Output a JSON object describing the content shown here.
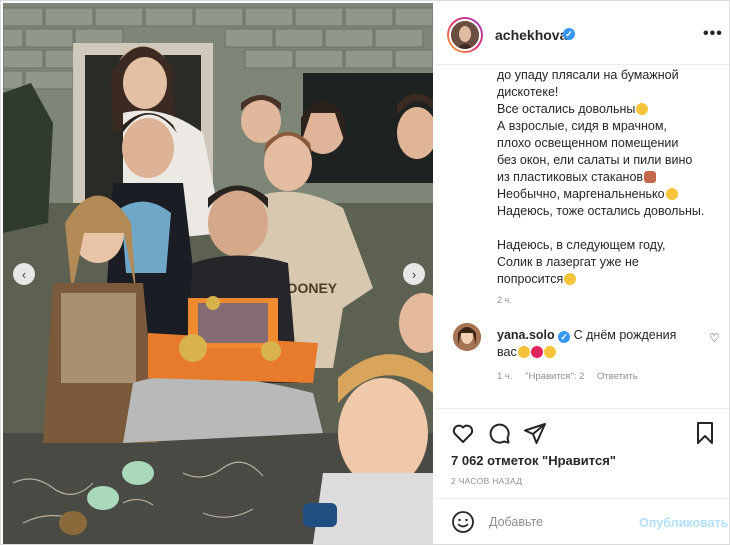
{
  "post": {
    "username": "achekhova",
    "verified": true,
    "more_label": "•••"
  },
  "caption": {
    "para1": "до упаду плясали на бумажной\nдискотеке!\nВсе остались довольны",
    "para1b": "А взрослые, сидя в мрачном,\nплохо освещенном помещении\nбез окон, ели салаты и пили вино\nиз пластиковых стаканов",
    "para1c": "Необычно, маргенальненько",
    "para1d": "Надеюсь, тоже остались довольны.",
    "para2": "Надеюсь, в следующем году,\nСолик в лазергат уже не\nпопросится",
    "time": "2 ч."
  },
  "comment": {
    "username": "yana.solo",
    "verified": true,
    "text": "С днём рождения вас",
    "time": "1 ч.",
    "likes": "\"Нравится\": 2",
    "reply": "Ответить"
  },
  "stats": {
    "likes": "7 062 отметок \"Нравится\"",
    "posted_ago": "2 ЧАСОВ НАЗАД"
  },
  "composer": {
    "placeholder": "Добавьте",
    "publish": "Опубликовать"
  },
  "photo_nav": {
    "prev": "‹",
    "next": "›"
  },
  "colors": {
    "brand_blue": "#3897f0",
    "publish_disabled": "#b2dffc",
    "meta_gray": "#8e8e8e",
    "text": "#262626"
  }
}
